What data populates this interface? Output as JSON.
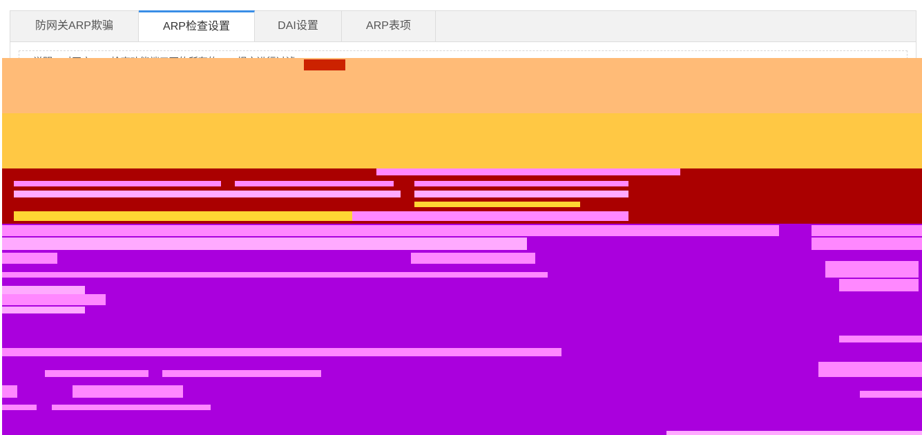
{
  "tabs": [
    {
      "label": "防网关ARP欺骗",
      "active": false
    },
    {
      "label": "ARP检查设置",
      "active": true
    },
    {
      "label": "DAI设置",
      "active": false
    },
    {
      "label": "ARP表项",
      "active": false
    }
  ],
  "note": {
    "text": "说明：对开启ARP检查功能端口下的所有的ARP报文进行过滤"
  },
  "colors": {
    "tab_active_border": "#3a8ee6",
    "band_orange": "#ffbb77",
    "band_yellow": "#ffc844",
    "band_darkred": "#aa0000",
    "band_purple": "#aa00dd",
    "streak_pink": "#ff88ff"
  }
}
